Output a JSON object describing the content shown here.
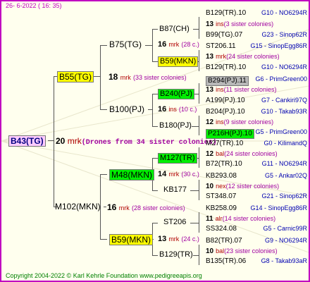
{
  "date": "26-  6-2022 (  16: 35)",
  "copyright": "Copyright 2004-2022 © Karl Kehrle Foundation   www.pedigreeapis.org",
  "root": {
    "label": "B43(TG)",
    "num": "20",
    "ins": "mrk",
    "desc": "(Drones from 34 sister colonies)"
  },
  "gen1": {
    "top": {
      "label": "B55(TG)",
      "num": "18",
      "ins": "mrk",
      "desc": "(33 sister colonies)"
    },
    "bottom": {
      "label": "M102(MKN)",
      "num": "16",
      "ins": "mrk",
      "desc": "(28 sister colonies)"
    }
  },
  "gen2": [
    {
      "label": "B75(TG)"
    },
    {
      "label": "B100(PJ)",
      "num": "16",
      "ins": "ins",
      "desc": "(10 c.)"
    },
    {
      "label": "M48(MKN)",
      "num": "14",
      "ins": "mrk",
      "desc": "(30 c.)"
    },
    {
      "label": "B59(MKN)",
      "num": "13",
      "ins": "mrk",
      "desc": "(24 c.)"
    }
  ],
  "gen3": [
    {
      "label": "B87(CH)",
      "num": "16",
      "ins": "mrk",
      "desc": "(28 c.)"
    },
    {
      "label": "B59(MKN)"
    },
    {
      "label": "B240(PJ)",
      "num": "16",
      "ins": "ins",
      "desc": "(10 c.)"
    },
    {
      "label": "B180(PJ)"
    },
    {
      "label": "M127(TR)",
      "num": "14",
      "ins": "mrk",
      "desc": "(30 c.)"
    },
    {
      "label": "KB177"
    },
    {
      "label": "ST206",
      "num": "13",
      "ins": "mrk",
      "desc": "(24 c.)"
    },
    {
      "label": "B129(TR)"
    }
  ],
  "gen4": [
    {
      "label": "B129(TR).10",
      "ref": "G10 - NO6294R"
    },
    {
      "num": "13",
      "ins": "ins",
      "desc": "(3 sister colonies)"
    },
    {
      "label": "B99(TG).07",
      "ref": "G23 - Sinop62R"
    },
    {
      "label": "ST206.11",
      "ref": "G15 - SinopEgg86R"
    },
    {
      "num": "13",
      "ins": "mrk",
      "desc": "(24 sister colonies)"
    },
    {
      "label": "B129(TR).10",
      "ref": "G10 - NO6294R"
    },
    {
      "label": "B294(PJ).11",
      "ref": "G6 - PrimGreen00"
    },
    {
      "num": "13",
      "ins": "ins",
      "desc": "(11 sister colonies)"
    },
    {
      "label": "A199(PJ).10",
      "ref": "G7 - Cankiri97Q"
    },
    {
      "label": "B204(PJ).10",
      "ref": "G10 - Takab93R"
    },
    {
      "num": "12",
      "ins": "ins",
      "desc": "(9 sister colonies)"
    },
    {
      "label": "P216H(PJ).10",
      "ref": "G5 - PrimGreen00"
    },
    {
      "label": "M27(TR).10",
      "ref": "G0 - KilimandQ"
    },
    {
      "num": "12",
      "ins": "bal",
      "desc": "(24 sister colonies)"
    },
    {
      "label": "B72(TR).10",
      "ref": "G11 - NO6294R"
    },
    {
      "label": "KB293.08",
      "ref": "G5 - Ankar02Q"
    },
    {
      "num": "10",
      "ins": "nex",
      "desc": "(12 sister colonies)"
    },
    {
      "label": "ST348.07",
      "ref": "G21 - Sinop62R"
    },
    {
      "label": "KB258.09",
      "ref": "G14 - SinopEgg86R"
    },
    {
      "num": "11",
      "ins": "alr",
      "desc": "(14 sister colonies)"
    },
    {
      "label": "SS324.08",
      "ref": "G5 - Carnic99R"
    },
    {
      "label": "B82(TR).07",
      "ref": "G9 - NO6294R"
    },
    {
      "num": "10",
      "ins": "bal",
      "desc": "(23 sister colonies)"
    },
    {
      "label": "B135(TR).06",
      "ref": "G8 - Takab93aR"
    }
  ]
}
